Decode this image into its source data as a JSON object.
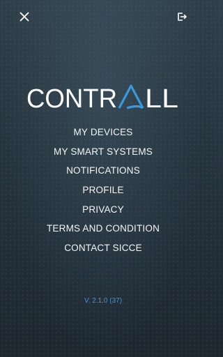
{
  "header": {
    "close_icon": "close-icon",
    "logout_icon": "logout-icon"
  },
  "logo": {
    "text": "CONTRALL",
    "prefix": "CONTR",
    "accent_letter": "A",
    "suffix": "LL",
    "accent_color": "#3a9ad9"
  },
  "menu": {
    "items": [
      {
        "label": "MY DEVICES"
      },
      {
        "label": "MY SMART SYSTEMS"
      },
      {
        "label": "NOTIFICATIONS"
      },
      {
        "label": "PROFILE"
      },
      {
        "label": "PRIVACY"
      },
      {
        "label": "TERMS AND CONDITION"
      },
      {
        "label": "CONTACT SICCE"
      }
    ]
  },
  "version": "V. 2.1.0 (37)",
  "colors": {
    "background": "#1e2a33",
    "text": "#ffffff",
    "accent": "#3a9ad9"
  }
}
